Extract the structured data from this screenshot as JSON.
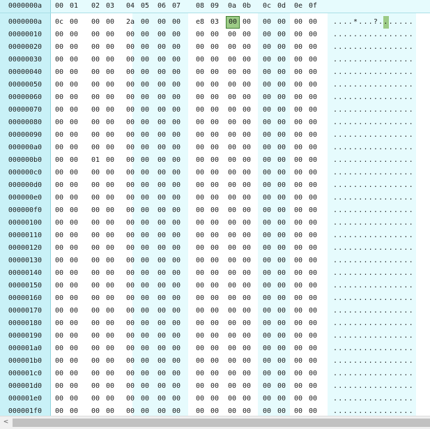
{
  "header": {
    "offset_label": "0000000a",
    "columns": [
      "00",
      "01",
      "02",
      "03",
      "04",
      "05",
      "06",
      "07",
      "08",
      "09",
      "0a",
      "0b",
      "0c",
      "0d",
      "0e",
      "0f"
    ]
  },
  "rows": [
    {
      "offset": "0000000a",
      "bytes": [
        "0c",
        "00",
        "00",
        "00",
        "2a",
        "00",
        "00",
        "00",
        "e8",
        "03",
        "00",
        "00",
        "00",
        "00",
        "00",
        "00"
      ],
      "ascii": "....*...?......."
    },
    {
      "offset": "00000010",
      "bytes": [
        "00",
        "00",
        "00",
        "00",
        "00",
        "00",
        "00",
        "00",
        "00",
        "00",
        "00",
        "00",
        "00",
        "00",
        "00",
        "00"
      ],
      "ascii": "................"
    },
    {
      "offset": "00000020",
      "bytes": [
        "00",
        "00",
        "00",
        "00",
        "00",
        "00",
        "00",
        "00",
        "00",
        "00",
        "00",
        "00",
        "00",
        "00",
        "00",
        "00"
      ],
      "ascii": "................"
    },
    {
      "offset": "00000030",
      "bytes": [
        "00",
        "00",
        "00",
        "00",
        "00",
        "00",
        "00",
        "00",
        "00",
        "00",
        "00",
        "00",
        "00",
        "00",
        "00",
        "00"
      ],
      "ascii": "................"
    },
    {
      "offset": "00000040",
      "bytes": [
        "00",
        "00",
        "00",
        "00",
        "00",
        "00",
        "00",
        "00",
        "00",
        "00",
        "00",
        "00",
        "00",
        "00",
        "00",
        "00"
      ],
      "ascii": "................"
    },
    {
      "offset": "00000050",
      "bytes": [
        "00",
        "00",
        "00",
        "00",
        "00",
        "00",
        "00",
        "00",
        "00",
        "00",
        "00",
        "00",
        "00",
        "00",
        "00",
        "00"
      ],
      "ascii": "................"
    },
    {
      "offset": "00000060",
      "bytes": [
        "00",
        "00",
        "00",
        "00",
        "00",
        "00",
        "00",
        "00",
        "00",
        "00",
        "00",
        "00",
        "00",
        "00",
        "00",
        "00"
      ],
      "ascii": "................"
    },
    {
      "offset": "00000070",
      "bytes": [
        "00",
        "00",
        "00",
        "00",
        "00",
        "00",
        "00",
        "00",
        "00",
        "00",
        "00",
        "00",
        "00",
        "00",
        "00",
        "00"
      ],
      "ascii": "................"
    },
    {
      "offset": "00000080",
      "bytes": [
        "00",
        "00",
        "00",
        "00",
        "00",
        "00",
        "00",
        "00",
        "00",
        "00",
        "00",
        "00",
        "00",
        "00",
        "00",
        "00"
      ],
      "ascii": "................"
    },
    {
      "offset": "00000090",
      "bytes": [
        "00",
        "00",
        "00",
        "00",
        "00",
        "00",
        "00",
        "00",
        "00",
        "00",
        "00",
        "00",
        "00",
        "00",
        "00",
        "00"
      ],
      "ascii": "................"
    },
    {
      "offset": "000000a0",
      "bytes": [
        "00",
        "00",
        "00",
        "00",
        "00",
        "00",
        "00",
        "00",
        "00",
        "00",
        "00",
        "00",
        "00",
        "00",
        "00",
        "00"
      ],
      "ascii": "................"
    },
    {
      "offset": "000000b0",
      "bytes": [
        "00",
        "00",
        "01",
        "00",
        "00",
        "00",
        "00",
        "00",
        "00",
        "00",
        "00",
        "00",
        "00",
        "00",
        "00",
        "00"
      ],
      "ascii": "................"
    },
    {
      "offset": "000000c0",
      "bytes": [
        "00",
        "00",
        "00",
        "00",
        "00",
        "00",
        "00",
        "00",
        "00",
        "00",
        "00",
        "00",
        "00",
        "00",
        "00",
        "00"
      ],
      "ascii": "................"
    },
    {
      "offset": "000000d0",
      "bytes": [
        "00",
        "00",
        "00",
        "00",
        "00",
        "00",
        "00",
        "00",
        "00",
        "00",
        "00",
        "00",
        "00",
        "00",
        "00",
        "00"
      ],
      "ascii": "................"
    },
    {
      "offset": "000000e0",
      "bytes": [
        "00",
        "00",
        "00",
        "00",
        "00",
        "00",
        "00",
        "00",
        "00",
        "00",
        "00",
        "00",
        "00",
        "00",
        "00",
        "00"
      ],
      "ascii": "................"
    },
    {
      "offset": "000000f0",
      "bytes": [
        "00",
        "00",
        "00",
        "00",
        "00",
        "00",
        "00",
        "00",
        "00",
        "00",
        "00",
        "00",
        "00",
        "00",
        "00",
        "00"
      ],
      "ascii": "................"
    },
    {
      "offset": "00000100",
      "bytes": [
        "00",
        "00",
        "00",
        "00",
        "00",
        "00",
        "00",
        "00",
        "00",
        "00",
        "00",
        "00",
        "00",
        "00",
        "00",
        "00"
      ],
      "ascii": "................"
    },
    {
      "offset": "00000110",
      "bytes": [
        "00",
        "00",
        "00",
        "00",
        "00",
        "00",
        "00",
        "00",
        "00",
        "00",
        "00",
        "00",
        "00",
        "00",
        "00",
        "00"
      ],
      "ascii": "................"
    },
    {
      "offset": "00000120",
      "bytes": [
        "00",
        "00",
        "00",
        "00",
        "00",
        "00",
        "00",
        "00",
        "00",
        "00",
        "00",
        "00",
        "00",
        "00",
        "00",
        "00"
      ],
      "ascii": "................"
    },
    {
      "offset": "00000130",
      "bytes": [
        "00",
        "00",
        "00",
        "00",
        "00",
        "00",
        "00",
        "00",
        "00",
        "00",
        "00",
        "00",
        "00",
        "00",
        "00",
        "00"
      ],
      "ascii": "................"
    },
    {
      "offset": "00000140",
      "bytes": [
        "00",
        "00",
        "00",
        "00",
        "00",
        "00",
        "00",
        "00",
        "00",
        "00",
        "00",
        "00",
        "00",
        "00",
        "00",
        "00"
      ],
      "ascii": "................"
    },
    {
      "offset": "00000150",
      "bytes": [
        "00",
        "00",
        "00",
        "00",
        "00",
        "00",
        "00",
        "00",
        "00",
        "00",
        "00",
        "00",
        "00",
        "00",
        "00",
        "00"
      ],
      "ascii": "................"
    },
    {
      "offset": "00000160",
      "bytes": [
        "00",
        "00",
        "00",
        "00",
        "00",
        "00",
        "00",
        "00",
        "00",
        "00",
        "00",
        "00",
        "00",
        "00",
        "00",
        "00"
      ],
      "ascii": "................"
    },
    {
      "offset": "00000170",
      "bytes": [
        "00",
        "00",
        "00",
        "00",
        "00",
        "00",
        "00",
        "00",
        "00",
        "00",
        "00",
        "00",
        "00",
        "00",
        "00",
        "00"
      ],
      "ascii": "................"
    },
    {
      "offset": "00000180",
      "bytes": [
        "00",
        "00",
        "00",
        "00",
        "00",
        "00",
        "00",
        "00",
        "00",
        "00",
        "00",
        "00",
        "00",
        "00",
        "00",
        "00"
      ],
      "ascii": "................"
    },
    {
      "offset": "00000190",
      "bytes": [
        "00",
        "00",
        "00",
        "00",
        "00",
        "00",
        "00",
        "00",
        "00",
        "00",
        "00",
        "00",
        "00",
        "00",
        "00",
        "00"
      ],
      "ascii": "................"
    },
    {
      "offset": "000001a0",
      "bytes": [
        "00",
        "00",
        "00",
        "00",
        "00",
        "00",
        "00",
        "00",
        "00",
        "00",
        "00",
        "00",
        "00",
        "00",
        "00",
        "00"
      ],
      "ascii": "................"
    },
    {
      "offset": "000001b0",
      "bytes": [
        "00",
        "00",
        "00",
        "00",
        "00",
        "00",
        "00",
        "00",
        "00",
        "00",
        "00",
        "00",
        "00",
        "00",
        "00",
        "00"
      ],
      "ascii": "................"
    },
    {
      "offset": "000001c0",
      "bytes": [
        "00",
        "00",
        "00",
        "00",
        "00",
        "00",
        "00",
        "00",
        "00",
        "00",
        "00",
        "00",
        "00",
        "00",
        "00",
        "00"
      ],
      "ascii": "................"
    },
    {
      "offset": "000001d0",
      "bytes": [
        "00",
        "00",
        "00",
        "00",
        "00",
        "00",
        "00",
        "00",
        "00",
        "00",
        "00",
        "00",
        "00",
        "00",
        "00",
        "00"
      ],
      "ascii": "................"
    },
    {
      "offset": "000001e0",
      "bytes": [
        "00",
        "00",
        "00",
        "00",
        "00",
        "00",
        "00",
        "00",
        "00",
        "00",
        "00",
        "00",
        "00",
        "00",
        "00",
        "00"
      ],
      "ascii": "................"
    },
    {
      "offset": "000001f0",
      "bytes": [
        "00",
        "00",
        "00",
        "00",
        "00",
        "00",
        "00",
        "00",
        "00",
        "00",
        "00",
        "00",
        "00",
        "00",
        "00",
        "00"
      ],
      "ascii": "................"
    }
  ],
  "selection": {
    "row": 0,
    "column": 10
  },
  "scrollbar": {
    "left_arrow_icon": "chevron-left-icon",
    "left_arrow_glyph": "<"
  },
  "colors": {
    "header_bg": "#e6fbfd",
    "offset_bg": "#c9f1f7",
    "selection_bg": "#9ccb86",
    "selection_border": "#3d7d2e"
  }
}
